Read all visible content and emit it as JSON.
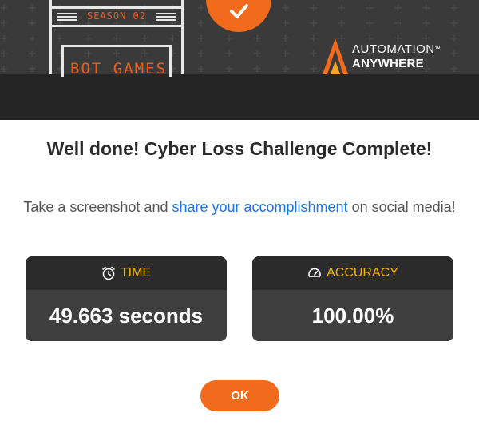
{
  "banner": {
    "season_label": "SEASON 02",
    "game_label": "BOT GAMES",
    "brand": {
      "line1": "AUTOMATION",
      "trademark": "™",
      "line2": "ANYWHERE"
    },
    "accent_color": "#f26b1d"
  },
  "dialog": {
    "title": "Well done! Cyber Loss Challenge Complete!",
    "subtitle_before": "Take a screenshot and ",
    "subtitle_link": "share your accomplishment",
    "subtitle_after": " on social media!"
  },
  "stats": {
    "time": {
      "label": "TIME",
      "value": "49.663 seconds",
      "icon": "alarm-clock-icon"
    },
    "accuracy": {
      "label": "ACCURACY",
      "value": "100.00%",
      "icon": "speedometer-icon"
    },
    "label_color": "#f5b800"
  },
  "actions": {
    "ok_label": "OK"
  }
}
